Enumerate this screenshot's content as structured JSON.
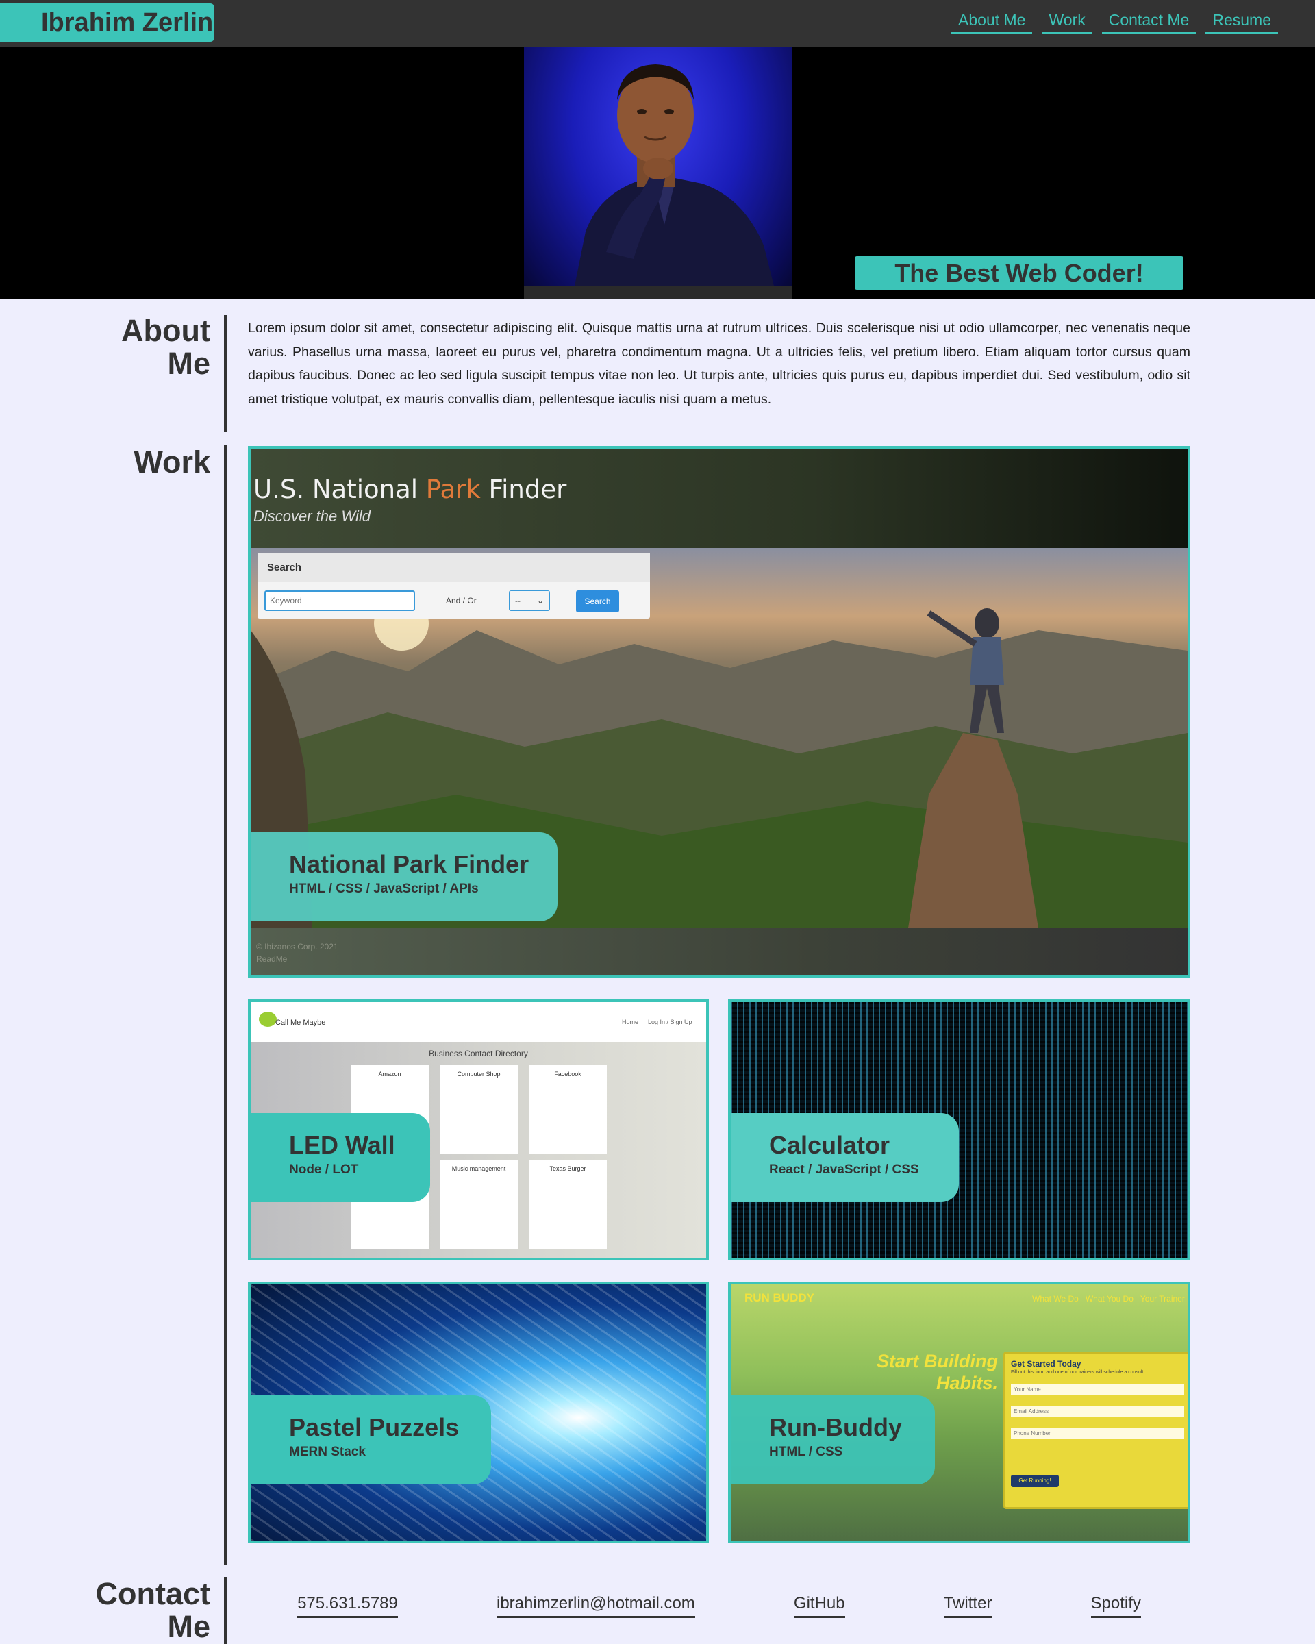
{
  "header": {
    "brand": "Ibrahim Zerlin",
    "nav": [
      "About Me",
      "Work",
      "Contact Me",
      "Resume"
    ]
  },
  "hero": {
    "tagline": "The Best Web Coder!"
  },
  "about": {
    "title_line1": "About",
    "title_line2": "Me",
    "text": "Lorem ipsum dolor sit amet, consectetur adipiscing elit. Quisque mattis urna at rutrum ultrices. Duis scelerisque nisi ut odio ullamcorper, nec venenatis neque varius. Phasellus urna massa, laoreet eu purus vel, pharetra condimentum magna. Ut a ultricies felis, vel pretium libero. Etiam aliquam tortor cursus quam dapibus faucibus. Donec ac leo sed ligula suscipit tempus vitae non leo. Ut turpis ante, ultricies quis purus eu, dapibus imperdiet dui. Sed vestibulum, odio sit amet tristique volutpat, ex mauris convallis diam, pellentesque iaculis nisi quam a metus."
  },
  "work": {
    "title": "Work",
    "featured": {
      "name": "National Park Finder",
      "tech": "HTML / CSS / JavaScript / APIs",
      "screenshot": {
        "title_a": "U.S. National ",
        "title_b": "Park",
        "title_c": " Finder",
        "subtitle": "Discover the Wild",
        "search_header": "Search",
        "keyword_placeholder": "Keyword",
        "andor": "And / Or",
        "select_value": "--",
        "search_button": "Search",
        "footer_line1": "© Ibizanos Corp. 2021",
        "footer_line2": "ReadMe"
      }
    },
    "projects": [
      {
        "name": "LED Wall",
        "tech": "Node / LOT",
        "screenshot": {
          "app_name": "Call Me Maybe",
          "nav": [
            "Home",
            "Log In / Sign Up"
          ],
          "heading": "Business Contact Directory",
          "businesses": [
            "Amazon",
            "Computer Shop",
            "Facebook",
            "Music management",
            "Texas Burger"
          ]
        }
      },
      {
        "name": "Calculator",
        "tech": "React / JavaScript / CSS"
      },
      {
        "name": "Pastel Puzzels",
        "tech": "MERN Stack"
      },
      {
        "name": "Run-Buddy",
        "tech": "HTML / CSS",
        "screenshot": {
          "logo": "RUN BUDDY",
          "nav": [
            "What We Do",
            "What You Do",
            "Your Trainer"
          ],
          "headline_line1": "Start Building",
          "headline_line2": "Habits.",
          "form_title": "Get Started Today",
          "form_sub": "Fill out this form and one of our trainers will schedule a consult.",
          "fields": [
            "Your Name",
            "Email Address",
            "Phone Number"
          ],
          "button": "Get Running!"
        }
      }
    ]
  },
  "contact": {
    "title_line1": "Contact",
    "title_line2": "Me",
    "links": [
      "575.631.5789",
      "ibrahimzerlin@hotmail.com",
      "GitHub",
      "Twitter",
      "Spotify"
    ]
  },
  "colors": {
    "accent": "#3cc4b8",
    "dark": "#333333",
    "page_bg": "#eeeefd"
  }
}
